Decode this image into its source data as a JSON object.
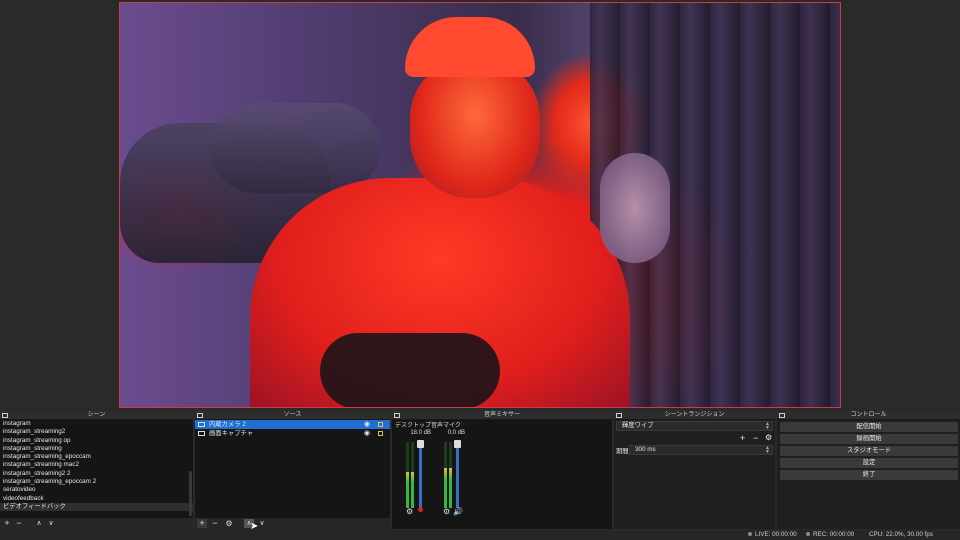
{
  "scenes_dock": {
    "title": "シーン",
    "items": [
      "instagram",
      "instagram_streaming2",
      "instagram_streaming op",
      "instagram_streaming",
      "instagram_streaming_epoccam",
      "instagram_streaming mac2",
      "instagram_streaming2 2",
      "instagram_streaming_epoccam 2",
      "seratovideo",
      "videofeedback",
      "ビデオフィードバック"
    ],
    "toolbar": {
      "add": "+",
      "remove": "−",
      "up": "∧",
      "down": "∨"
    }
  },
  "sources_dock": {
    "title": "ソース",
    "items": [
      {
        "label": "内蔵カメラ 2",
        "icon": "camera-icon"
      },
      {
        "label": "画面キャプチャ",
        "icon": "monitor-icon"
      }
    ],
    "toolbar": {
      "add": "+",
      "remove": "−",
      "settings": "⚙",
      "up": "∧",
      "down": "∨"
    }
  },
  "mixer_dock": {
    "title": "音声ミキサー",
    "channels": [
      {
        "name": "デスクトップ音声",
        "db": "18.0 dB",
        "level": 0.55,
        "muted": true
      },
      {
        "name": "マイク",
        "db": "0.0 dB",
        "level": 0.6,
        "muted": false
      }
    ]
  },
  "transitions_dock": {
    "title": "シーントランジション",
    "transition": "輝度ワイプ",
    "duration_label": "期間",
    "duration_value": "300 ms",
    "add": "+",
    "remove": "−",
    "settings": "⚙"
  },
  "controls_dock": {
    "title": "コントロール",
    "buttons": [
      "配信開始",
      "録画開始",
      "スタジオモード",
      "設定",
      "終了"
    ]
  },
  "status": {
    "live": "LIVE: 00:00:00",
    "rec": "REC: 00:00:00",
    "cpu": "CPU: 22.0%, 30.00 fps"
  },
  "colors": {
    "accent_selected": "#1e6fd0",
    "preview_border": "#d2384a",
    "meter_green": "#37b640",
    "mute_red": "#e02424"
  }
}
